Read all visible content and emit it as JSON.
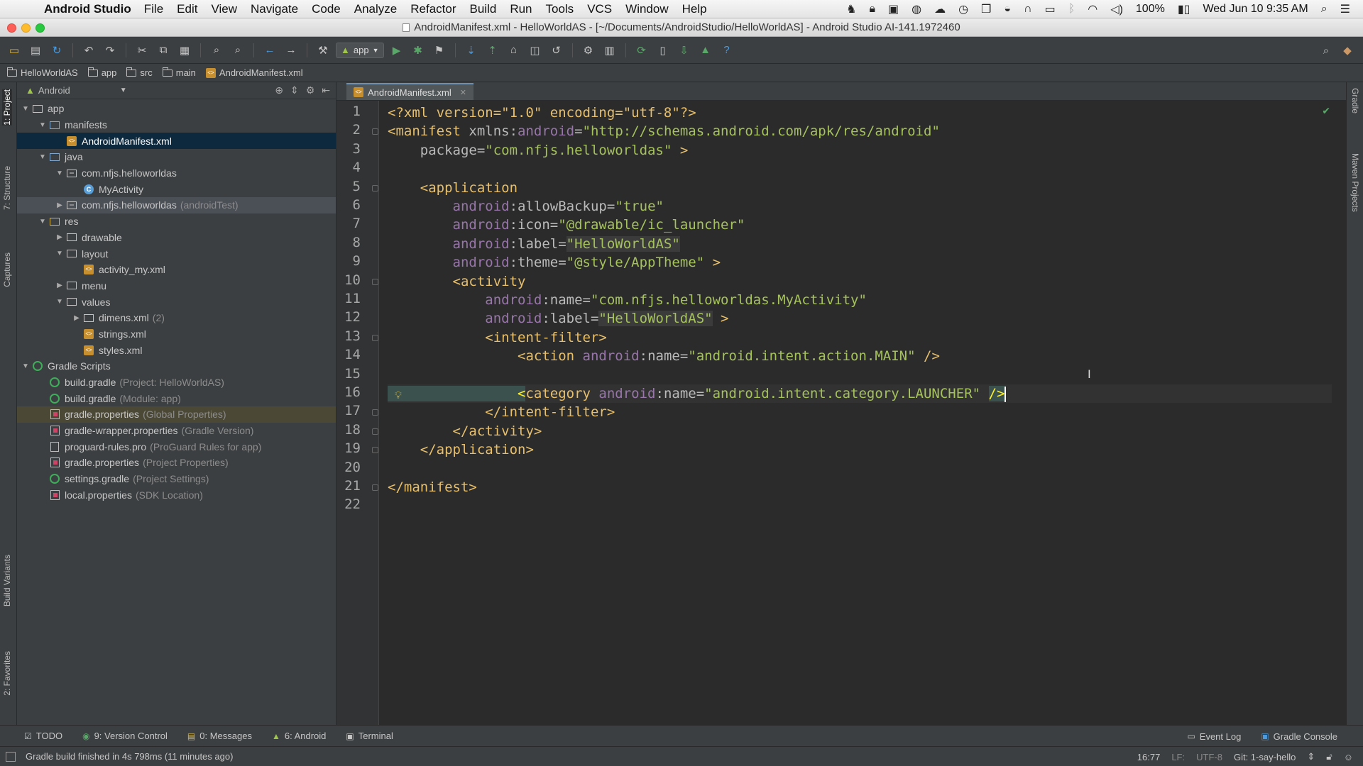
{
  "os_menubar": {
    "app_name": "Android Studio",
    "menus": [
      "File",
      "Edit",
      "View",
      "Navigate",
      "Code",
      "Analyze",
      "Refactor",
      "Build",
      "Run",
      "Tools",
      "VCS",
      "Window",
      "Help"
    ],
    "battery": "100%",
    "clock": "Wed Jun 10  9:35 AM"
  },
  "window": {
    "title": "AndroidManifest.xml - HelloWorldAS - [~/Documents/AndroidStudio/HelloWorldAS] - Android Studio AI-141.1972460"
  },
  "toolbar": {
    "run_config": "app"
  },
  "breadcrumbs": [
    "HelloWorldAS",
    "app",
    "src",
    "main",
    "AndroidManifest.xml"
  ],
  "left_strip": {
    "tabs": [
      "1: Project",
      "7: Structure",
      "Captures",
      "Build Variants",
      "2: Favorites"
    ]
  },
  "right_strip": {
    "tabs": [
      "Gradle",
      "Maven Projects"
    ]
  },
  "project_panel": {
    "view_selector": "Android",
    "tree": [
      {
        "label": "app",
        "note": "",
        "depth": 0,
        "arrow": "▼",
        "icon": "folder-icon"
      },
      {
        "label": "manifests",
        "note": "",
        "depth": 1,
        "arrow": "▼",
        "icon": "folder-icon"
      },
      {
        "label": "AndroidManifest.xml",
        "note": "",
        "depth": 2,
        "arrow": "",
        "icon": "xml-file-icon"
      },
      {
        "label": "java",
        "note": "",
        "depth": 1,
        "arrow": "▼",
        "icon": "folder-icon"
      },
      {
        "label": "com.nfjs.helloworldas",
        "note": "",
        "depth": 2,
        "arrow": "▼",
        "icon": "package-icon"
      },
      {
        "label": "MyActivity",
        "note": "",
        "depth": 3,
        "arrow": "",
        "icon": "class-icon"
      },
      {
        "label": "com.nfjs.helloworldas",
        "note": "(androidTest)",
        "depth": 2,
        "arrow": "▶",
        "icon": "package-icon"
      },
      {
        "label": "res",
        "note": "",
        "depth": 1,
        "arrow": "▼",
        "icon": "folder-icon"
      },
      {
        "label": "drawable",
        "note": "",
        "depth": 2,
        "arrow": "▶",
        "icon": "folder-icon"
      },
      {
        "label": "layout",
        "note": "",
        "depth": 2,
        "arrow": "▼",
        "icon": "folder-icon"
      },
      {
        "label": "activity_my.xml",
        "note": "",
        "depth": 3,
        "arrow": "",
        "icon": "xml-file-icon"
      },
      {
        "label": "menu",
        "note": "",
        "depth": 2,
        "arrow": "▶",
        "icon": "folder-icon"
      },
      {
        "label": "values",
        "note": "",
        "depth": 2,
        "arrow": "▼",
        "icon": "folder-icon"
      },
      {
        "label": "dimens.xml",
        "note": "(2)",
        "depth": 3,
        "arrow": "▶",
        "icon": "folder-icon"
      },
      {
        "label": "strings.xml",
        "note": "",
        "depth": 3,
        "arrow": "",
        "icon": "xml-file-icon"
      },
      {
        "label": "styles.xml",
        "note": "",
        "depth": 3,
        "arrow": "",
        "icon": "xml-file-icon"
      },
      {
        "label": "Gradle Scripts",
        "note": "",
        "depth": 0,
        "arrow": "▼",
        "icon": "gradle-icon"
      },
      {
        "label": "build.gradle",
        "note": "(Project: HelloWorldAS)",
        "depth": 1,
        "arrow": "",
        "icon": "gradle-icon"
      },
      {
        "label": "build.gradle",
        "note": "(Module: app)",
        "depth": 1,
        "arrow": "",
        "icon": "gradle-icon"
      },
      {
        "label": "gradle.properties",
        "note": "(Global Properties)",
        "depth": 1,
        "arrow": "",
        "icon": "properties-icon"
      },
      {
        "label": "gradle-wrapper.properties",
        "note": "(Gradle Version)",
        "depth": 1,
        "arrow": "",
        "icon": "properties-icon"
      },
      {
        "label": "proguard-rules.pro",
        "note": "(ProGuard Rules for app)",
        "depth": 1,
        "arrow": "",
        "icon": "file-icon"
      },
      {
        "label": "gradle.properties",
        "note": "(Project Properties)",
        "depth": 1,
        "arrow": "",
        "icon": "properties-icon"
      },
      {
        "label": "settings.gradle",
        "note": "(Project Settings)",
        "depth": 1,
        "arrow": "",
        "icon": "gradle-icon"
      },
      {
        "label": "local.properties",
        "note": "(SDK Location)",
        "depth": 1,
        "arrow": "",
        "icon": "properties-icon"
      }
    ]
  },
  "editor": {
    "tab_label": "AndroidManifest.xml",
    "lines": [
      [
        [
          "t-tag",
          "<?xml version=\"1.0\" encoding=\"utf-8\"?>"
        ]
      ],
      [
        [
          "t-tag",
          "<manifest "
        ],
        [
          "t-attr",
          "xmlns:"
        ],
        [
          "t-ns",
          "android"
        ],
        [
          "t-attr",
          "="
        ],
        [
          "t-val",
          "\"http://schemas.android.com/apk/res/android\""
        ]
      ],
      [
        [
          "t-attr",
          "    package="
        ],
        [
          "t-val",
          "\"com.nfjs.helloworldas\""
        ],
        [
          "t-tag",
          " >"
        ]
      ],
      [],
      [
        [
          "t-tag",
          "    <application"
        ]
      ],
      [
        [
          "t-ns",
          "        android"
        ],
        [
          "t-attr",
          ":allowBackup="
        ],
        [
          "t-val",
          "\"true\""
        ]
      ],
      [
        [
          "t-ns",
          "        android"
        ],
        [
          "t-attr",
          ":icon="
        ],
        [
          "t-val",
          "\"@drawable/ic_launcher\""
        ]
      ],
      [
        [
          "t-ns",
          "        android"
        ],
        [
          "t-attr",
          ":label="
        ],
        [
          "t-val t-hl",
          "\"HelloWorldAS\""
        ]
      ],
      [
        [
          "t-ns",
          "        android"
        ],
        [
          "t-attr",
          ":theme="
        ],
        [
          "t-val",
          "\"@style/AppTheme\""
        ],
        [
          "t-tag",
          " >"
        ]
      ],
      [
        [
          "t-tag",
          "        <activity"
        ]
      ],
      [
        [
          "t-ns",
          "            android"
        ],
        [
          "t-attr",
          ":name="
        ],
        [
          "t-val",
          "\"com.nfjs.helloworldas.MyActivity\""
        ]
      ],
      [
        [
          "t-ns",
          "            android"
        ],
        [
          "t-attr",
          ":label="
        ],
        [
          "t-val t-hl",
          "\"HelloWorldAS\""
        ],
        [
          "t-tag",
          " >"
        ]
      ],
      [
        [
          "t-tag",
          "            <intent-filter>"
        ]
      ],
      [
        [
          "t-tag",
          "                <action "
        ],
        [
          "t-ns",
          "android"
        ],
        [
          "t-attr",
          ":name="
        ],
        [
          "t-val",
          "\"android.intent.action.MAIN\""
        ],
        [
          "t-tag",
          " />"
        ]
      ],
      [],
      [
        [
          "t-tag t-bracket",
          "                <"
        ],
        [
          "t-tag",
          "category "
        ],
        [
          "t-ns",
          "android"
        ],
        [
          "t-attr",
          ":name="
        ],
        [
          "t-val",
          "\"android.intent.category.LAUNCHER\""
        ],
        [
          "t-tag",
          " "
        ],
        [
          "t-tag t-bracket",
          "/>"
        ]
      ],
      [
        [
          "t-tag",
          "            </intent-filter>"
        ]
      ],
      [
        [
          "t-tag",
          "        </activity>"
        ]
      ],
      [
        [
          "t-tag",
          "    </application>"
        ]
      ],
      [],
      [
        [
          "t-tag",
          "</manifest>"
        ]
      ],
      []
    ]
  },
  "bottom_tools": {
    "left": [
      "TODO",
      "9: Version Control",
      "0: Messages",
      "6: Android",
      "Terminal"
    ],
    "right": [
      "Event Log",
      "Gradle Console"
    ]
  },
  "status_bar": {
    "message": "Gradle build finished in 4s 798ms (11 minutes ago)",
    "position": "16:77",
    "line_sep": "LF:",
    "encoding": "UTF-8",
    "vcs": "Git: 1-say-hello"
  }
}
